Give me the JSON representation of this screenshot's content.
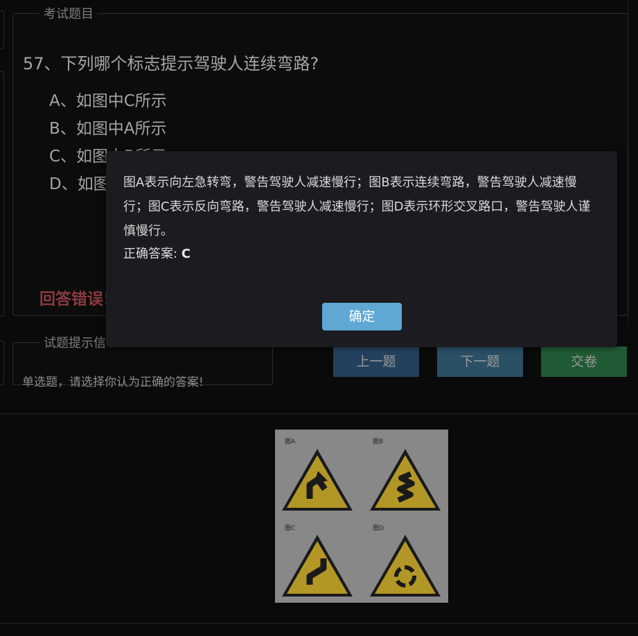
{
  "question_panel": {
    "legend": "考试题目",
    "question": "57、下列哪个标志提示驾驶人连续弯路?",
    "options": [
      "A、如图中C所示",
      "B、如图中A所示",
      "C、如图中B所示",
      "D、如图"
    ],
    "result": "回答错误!"
  },
  "hint_panel": {
    "legend": "试题提示信",
    "text": "单选题，请选择你认为正确的答案!"
  },
  "buttons": {
    "prev": "上一题",
    "next": "下一题",
    "submit": "交卷"
  },
  "image": {
    "signs": [
      {
        "label": "图A",
        "icon": "sharp-left-turn-sign"
      },
      {
        "label": "图B",
        "icon": "continuous-curves-sign"
      },
      {
        "label": "图C",
        "icon": "reverse-curve-sign"
      },
      {
        "label": "图D",
        "icon": "roundabout-sign"
      }
    ]
  },
  "modal": {
    "explanation": "图A表示向左急转弯，警告驾驶人减速慢行；图B表示连续弯路，警告驾驶人减速慢行；图C表示反向弯路，警告驾驶人减速慢行；图D表示环形交叉路口，警告驾驶人谨慎慢行。",
    "answer_label": "正确答案:",
    "answer_value": "C",
    "ok": "确定"
  },
  "colors": {
    "wrong": "#8a3a3f",
    "ok_button": "#5fa8d3",
    "sign_yellow": "#b39726"
  }
}
